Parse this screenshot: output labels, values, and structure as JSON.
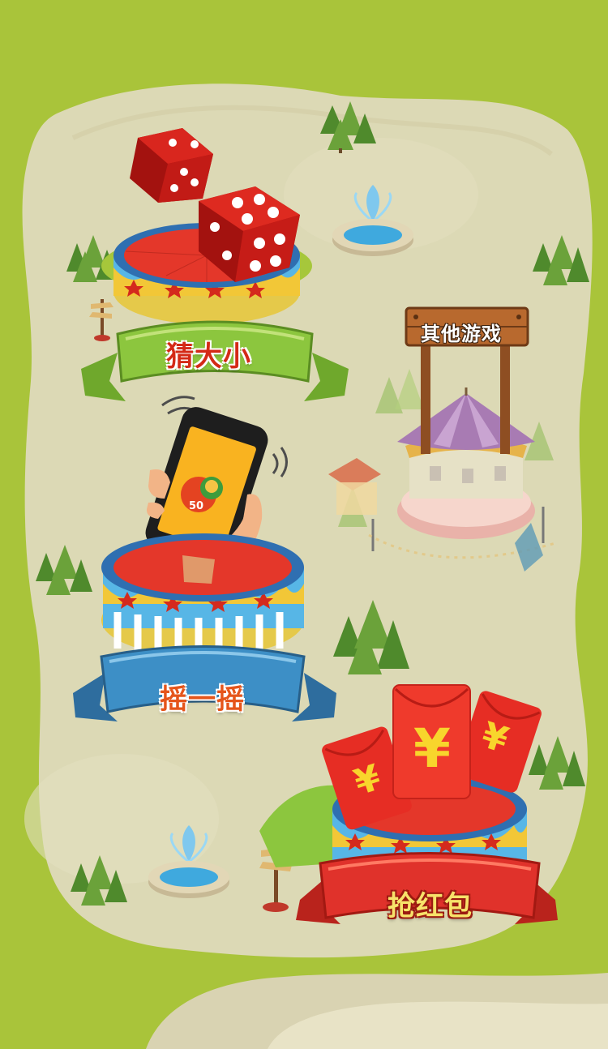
{
  "games": {
    "guess_size": {
      "label": "猜大小"
    },
    "shake": {
      "label": "摇一摇",
      "phone_value": "50"
    },
    "red_packet": {
      "label": "抢红包",
      "symbol": "¥"
    },
    "other_games": {
      "label": "其他游戏"
    }
  },
  "colors": {
    "grass": "#a9c43a",
    "path": "#dcd9b5",
    "banner_green": "#8cc63e",
    "banner_blue": "#3d8fc6",
    "banner_red": "#e0322b",
    "pedestal_red": "#e4372a",
    "wood": "#a0582a"
  },
  "icons": [
    "dice-icon",
    "phone-icon",
    "red-envelope-icon",
    "carousel-icon",
    "fountain-icon",
    "tree-icon",
    "signpost-icon"
  ]
}
